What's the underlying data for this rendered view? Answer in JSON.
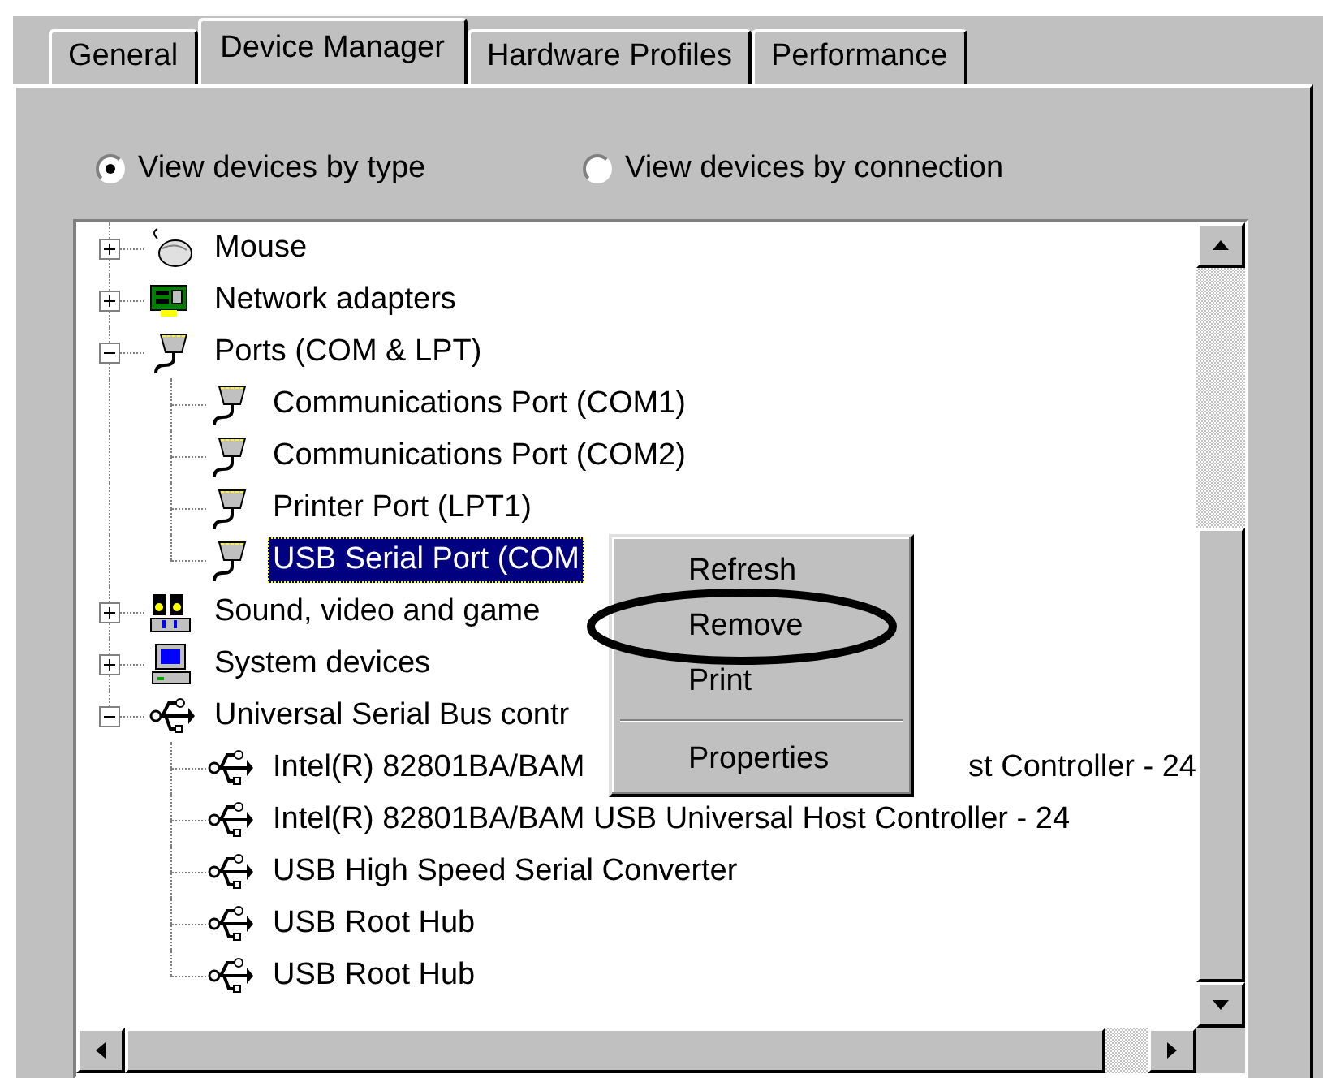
{
  "tabs": [
    {
      "label": "General",
      "selected": false
    },
    {
      "label": "Device Manager",
      "selected": true
    },
    {
      "label": "Hardware Profiles",
      "selected": false
    },
    {
      "label": "Performance",
      "selected": false
    }
  ],
  "view_options": [
    {
      "label": "View devices by type",
      "selected": true
    },
    {
      "label": "View devices by connection",
      "selected": false
    }
  ],
  "device_tree": [
    {
      "label": "Mouse",
      "kind": "mouse",
      "expanded": false,
      "selected": false
    },
    {
      "label": "Network adapters",
      "kind": "network",
      "expanded": false,
      "selected": false
    },
    {
      "label": "Ports (COM & LPT)",
      "kind": "port",
      "expanded": true,
      "selected": false,
      "children": [
        {
          "label": "Communications Port (COM1)",
          "kind": "port",
          "selected": false
        },
        {
          "label": "Communications Port (COM2)",
          "kind": "port",
          "selected": false
        },
        {
          "label": "Printer Port (LPT1)",
          "kind": "port",
          "selected": false
        },
        {
          "label": "USB Serial Port (COM",
          "kind": "port",
          "selected": true
        }
      ]
    },
    {
      "label": "Sound, video and game",
      "kind": "sound",
      "expanded": false,
      "selected": false
    },
    {
      "label": "System devices",
      "kind": "system",
      "expanded": false,
      "selected": false
    },
    {
      "label": "Universal Serial Bus contr",
      "kind": "usb",
      "expanded": true,
      "selected": false,
      "children": [
        {
          "label": "Intel(R) 82801BA/BAM",
          "label_end": "st Controller - 24",
          "kind": "usb",
          "selected": false
        },
        {
          "label": "Intel(R) 82801BA/BAM USB Universal Host Controller - 24",
          "kind": "usb",
          "selected": false
        },
        {
          "label": "USB High Speed Serial Converter",
          "kind": "usb",
          "selected": false
        },
        {
          "label": "USB Root Hub",
          "kind": "usb",
          "selected": false
        },
        {
          "label": "USB Root Hub",
          "kind": "usb",
          "selected": false
        }
      ]
    }
  ],
  "context_menu": [
    {
      "kind": "item",
      "label": "Refresh",
      "circled": false
    },
    {
      "kind": "item",
      "label": "Remove",
      "circled": true
    },
    {
      "kind": "item",
      "label": "Print",
      "circled": false
    },
    {
      "kind": "separator"
    },
    {
      "kind": "item",
      "label": "Properties",
      "circled": false
    }
  ]
}
